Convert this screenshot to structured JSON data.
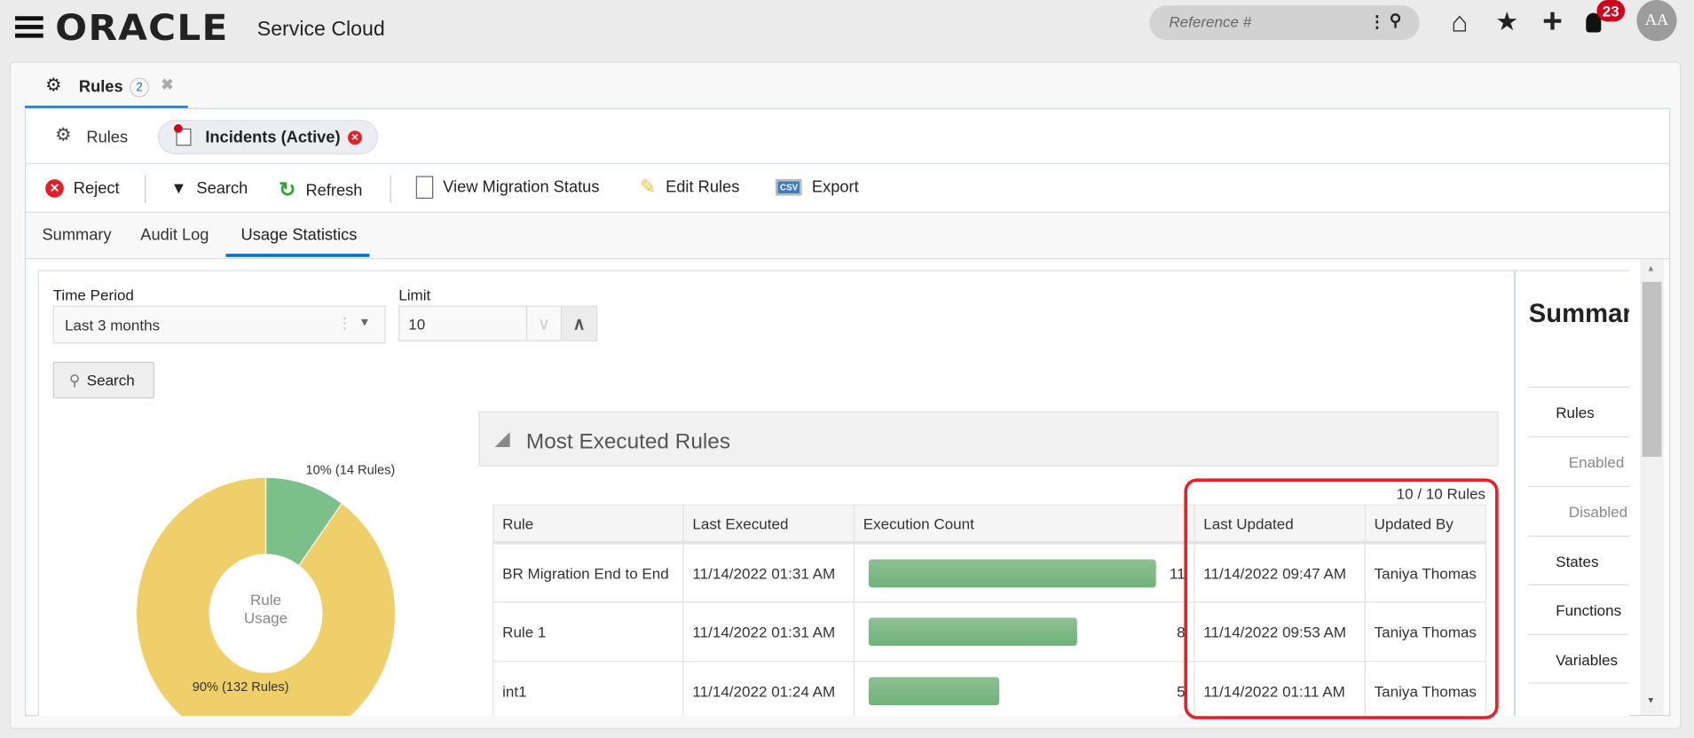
{
  "header": {
    "logo": "ORACLE",
    "product": "Service Cloud",
    "search_placeholder": "Reference #",
    "notification_count": "23",
    "avatar_initials": "AA"
  },
  "main_tab": {
    "label": "Rules",
    "count": "2"
  },
  "subtabs": {
    "rules": "Rules",
    "incidents": "Incidents (Active)"
  },
  "toolbar": {
    "reject": "Reject",
    "search": "Search",
    "refresh": "Refresh",
    "view_migration": "View Migration Status",
    "edit_rules": "Edit Rules",
    "export": "Export",
    "export_icon_text": "CSV"
  },
  "tabs": [
    "Summary",
    "Audit Log",
    "Usage Statistics"
  ],
  "form": {
    "time_period_label": "Time Period",
    "time_period_value": "Last 3 months",
    "limit_label": "Limit",
    "limit_value": "10",
    "search_button": "Search"
  },
  "chart_data": {
    "type": "pie",
    "title": "Rule Usage",
    "center_label_1": "Rule",
    "center_label_2": "Usage",
    "slices": [
      {
        "label": "10% (14 Rules)",
        "value": 14,
        "percent": 10,
        "color": "#7bbf8a"
      },
      {
        "label": "90% (132 Rules)",
        "value": 132,
        "percent": 90,
        "color": "#efcf69"
      }
    ]
  },
  "section": {
    "title": "Most Executed Rules",
    "count_text": "10 / 10 Rules"
  },
  "table": {
    "columns": [
      "Rule",
      "Last Executed",
      "Execution Count",
      "Last Updated",
      "Updated By"
    ],
    "rows": [
      {
        "rule": "BR Migration End to End",
        "last_executed": "11/14/2022 01:31 AM",
        "count": 11,
        "count_text": "11",
        "last_updated": "11/14/2022 09:47 AM",
        "updated_by": "Taniya Thomas"
      },
      {
        "rule": "Rule 1",
        "last_executed": "11/14/2022 01:31 AM",
        "count": 8,
        "count_text": "8",
        "last_updated": "11/14/2022 09:53 AM",
        "updated_by": "Taniya Thomas"
      },
      {
        "rule": "int1",
        "last_executed": "11/14/2022 01:24 AM",
        "count": 5,
        "count_text": "5",
        "last_updated": "11/14/2022 01:11 AM",
        "updated_by": "Taniya Thomas"
      }
    ]
  },
  "summary": {
    "title": "Summar",
    "items": [
      "Rules",
      "Enabled",
      "Disabled",
      "States",
      "Functions",
      "Variables"
    ]
  },
  "colors": {
    "accent": "#0572ce",
    "highlight": "#e8202a",
    "bar": "#7bb886"
  }
}
